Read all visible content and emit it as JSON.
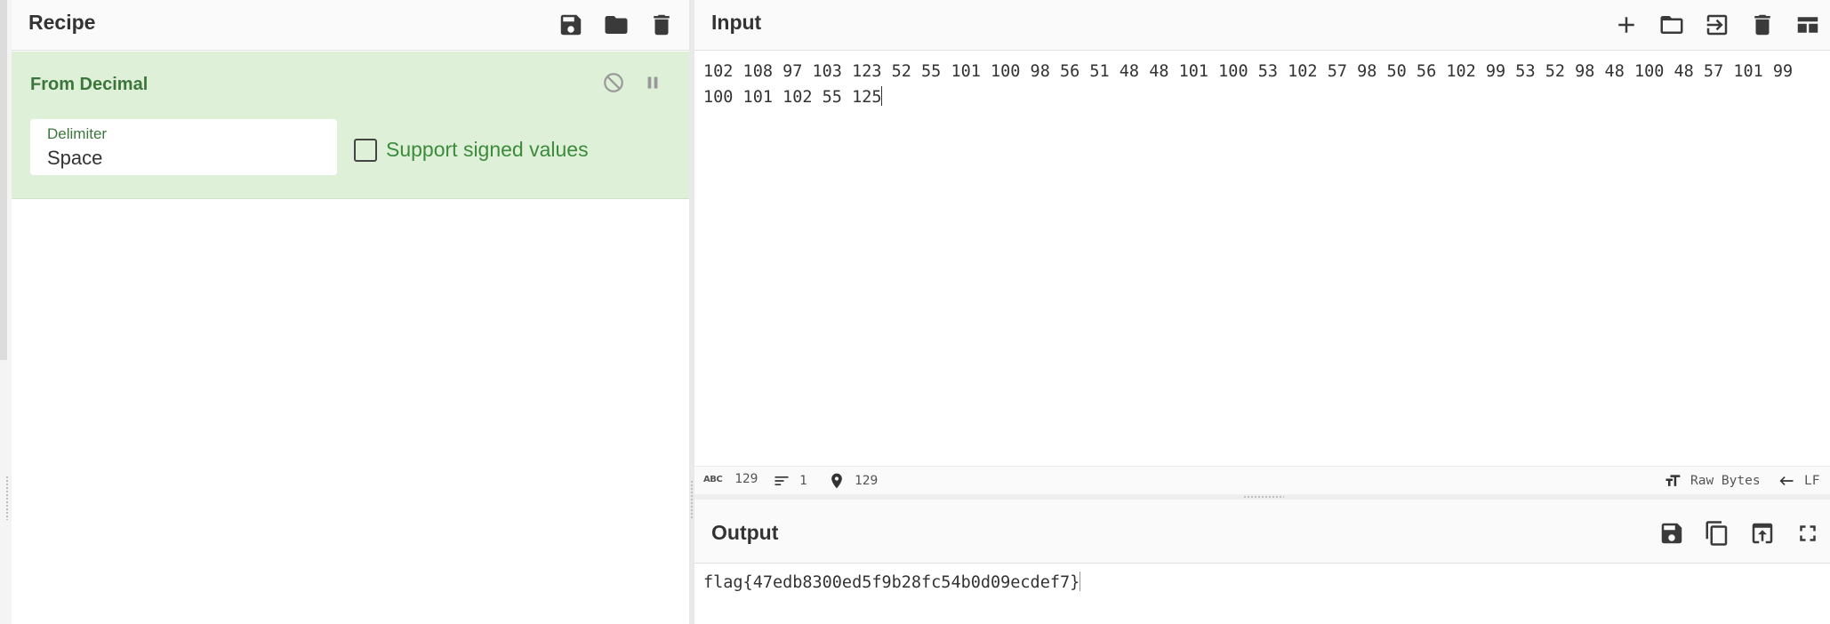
{
  "recipe": {
    "title": "Recipe",
    "icons": [
      "save-icon",
      "folder-icon",
      "trash-icon"
    ],
    "operation": {
      "name": "From Decimal",
      "delimiter_label": "Delimiter",
      "delimiter_value": "Space",
      "signed_label": "Support signed values",
      "signed_checked": false,
      "icons": [
        "disable-icon",
        "pause-icon"
      ]
    }
  },
  "input": {
    "title": "Input",
    "icons": [
      "plus-icon",
      "open-folder-icon",
      "import-icon",
      "trash-icon",
      "layout-icon"
    ],
    "text": "102 108 97 103 123 52 55 101 100 98 56 51 48 48 101 100 53 102 57 98 50 56 102 99 53 52 98 48 100 48 57 101 99 100 101 102 55 125",
    "status": {
      "length": "129",
      "lines": "1",
      "position": "129",
      "encoding": "Raw Bytes",
      "eol": "LF"
    }
  },
  "output": {
    "title": "Output",
    "icons": [
      "save-icon",
      "copy-icon",
      "replace-input-icon",
      "maximize-icon"
    ],
    "text": "flag{47edb8300ed5f9b28fc54b0d09ecdef7}"
  },
  "colors": {
    "operation_bg": "#dff0d8",
    "operation_text": "#3c763d",
    "header_bg": "#fafafa"
  }
}
